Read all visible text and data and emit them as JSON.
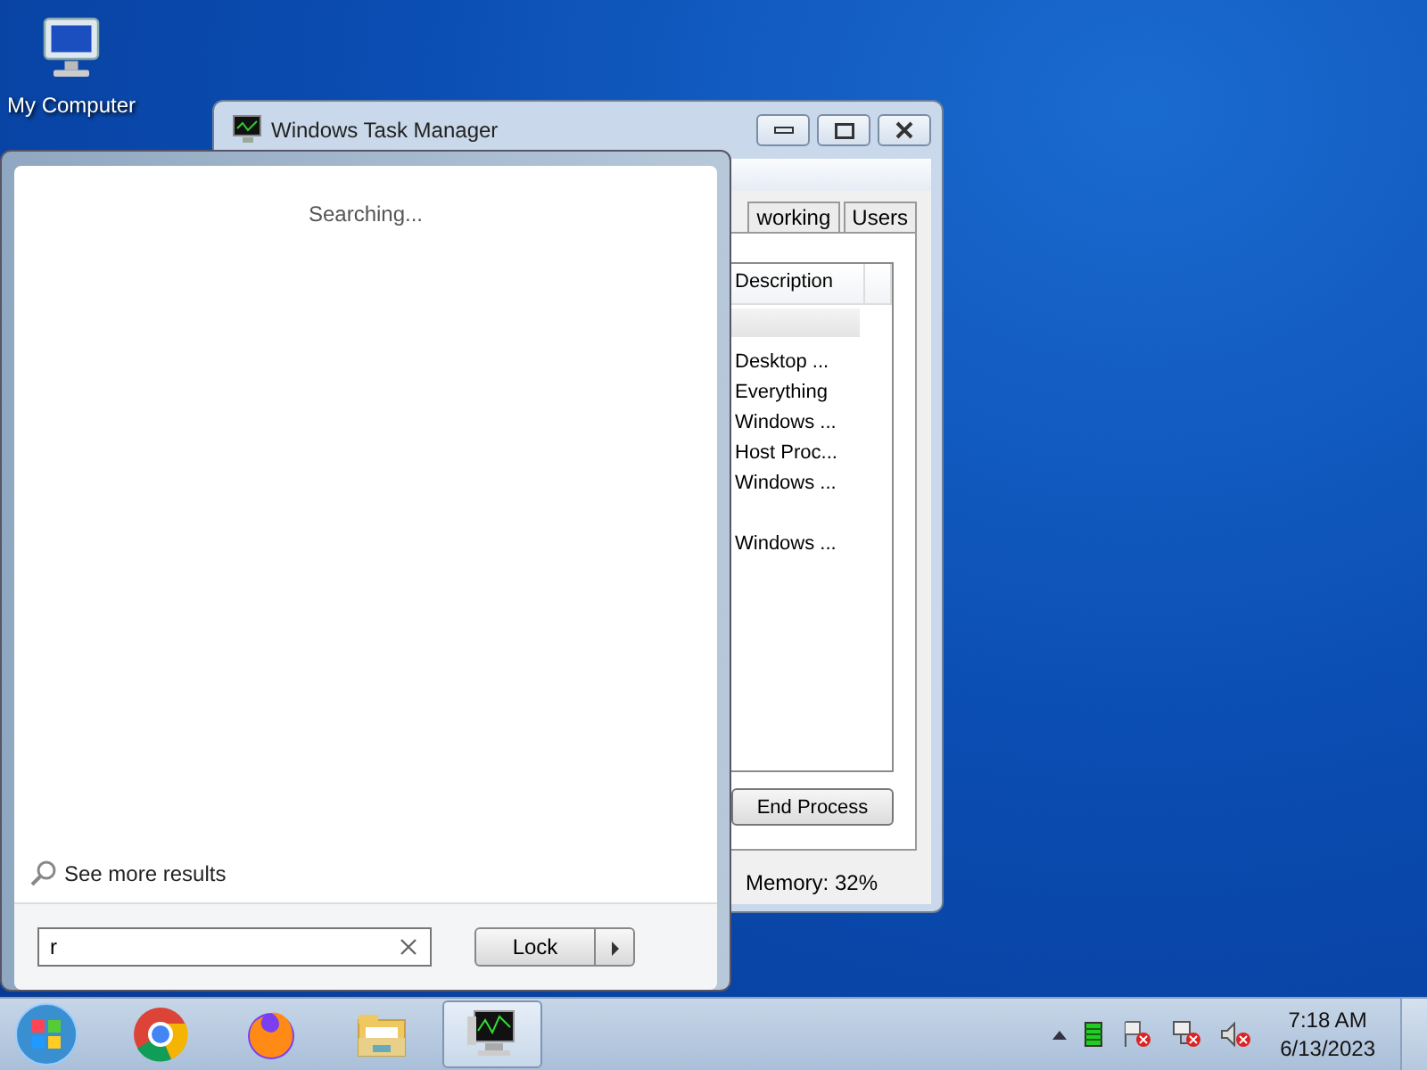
{
  "desktop_icons": [
    {
      "label": "My Computer"
    }
  ],
  "task_manager": {
    "title": "Windows Task Manager",
    "tabs": [
      {
        "label": "working",
        "selected": false
      },
      {
        "label": "Users",
        "selected": false
      }
    ],
    "columns": [
      "Description"
    ],
    "rows": [
      {
        "description": "Desktop ..."
      },
      {
        "description": "Everything"
      },
      {
        "description": "Windows ..."
      },
      {
        "description": "Host Proc..."
      },
      {
        "description": "Windows ..."
      },
      {},
      {
        "description": "Windows ..."
      }
    ],
    "end_button": "End Process",
    "status": "Memory: 32%"
  },
  "start_menu": {
    "status": "Searching...",
    "more_link": "See more results",
    "search": {
      "value": "r"
    },
    "lock_button": "Lock"
  },
  "taskbar": {
    "items": [
      {
        "kind": "chrome",
        "selected": false
      },
      {
        "kind": "firefox",
        "selected": false
      },
      {
        "kind": "folder",
        "selected": false
      },
      {
        "kind": "taskmgr",
        "selected": true
      }
    ],
    "time": "7:18 AM",
    "date": "6/13/2023"
  }
}
